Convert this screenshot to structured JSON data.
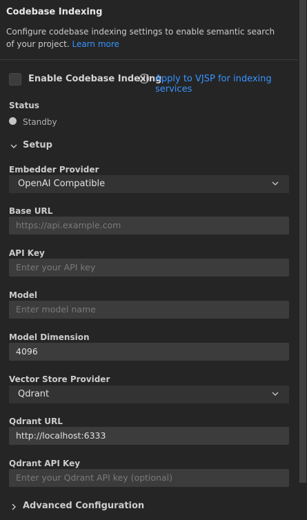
{
  "header": {
    "title": "Codebase Indexing",
    "description": "Configure codebase indexing settings to enable semantic search of your project.",
    "learn_more": "Learn more"
  },
  "enable": {
    "label": "Enable Codebase Indexing",
    "checked": false,
    "info_icon": "info-icon",
    "apply_link": "Apply to VJSP for indexing services"
  },
  "status": {
    "label": "Status",
    "value": "Standby",
    "dot_color": "#c5c5c5"
  },
  "setup": {
    "label": "Setup",
    "expanded": true
  },
  "fields": {
    "embedder_provider": {
      "label": "Embedder Provider",
      "value": "OpenAI Compatible"
    },
    "base_url": {
      "label": "Base URL",
      "placeholder": "https://api.example.com"
    },
    "api_key": {
      "label": "API Key",
      "placeholder": "Enter your API key"
    },
    "model": {
      "label": "Model",
      "placeholder": "Enter model name"
    },
    "model_dimension": {
      "label": "Model Dimension",
      "value": "4096"
    },
    "vector_store_provider": {
      "label": "Vector Store Provider",
      "value": "Qdrant"
    },
    "qdrant_url": {
      "label": "Qdrant URL",
      "value": "http://localhost:6333"
    },
    "qdrant_api_key": {
      "label": "Qdrant API Key",
      "placeholder": "Enter your Qdrant API key (optional)"
    }
  },
  "advanced": {
    "label": "Advanced Configuration",
    "expanded": false
  },
  "colors": {
    "background": "#252526",
    "input_background": "#3c3c3c",
    "link": "#3794ff"
  }
}
